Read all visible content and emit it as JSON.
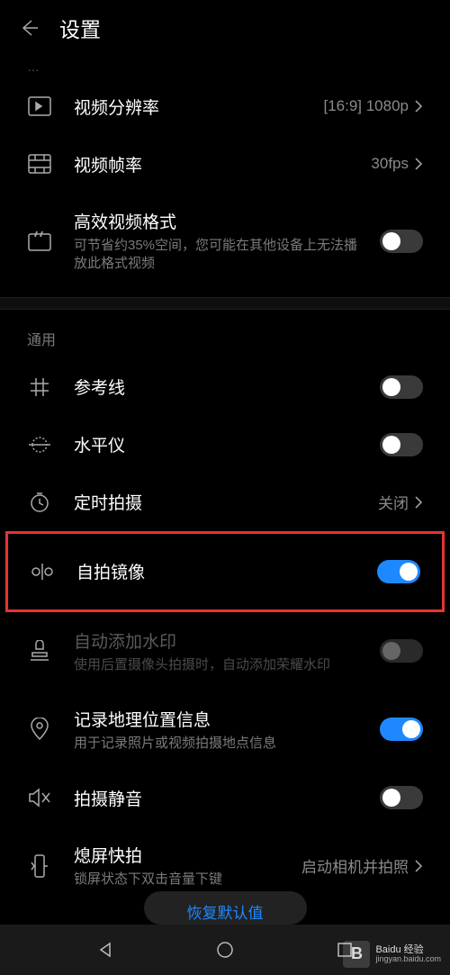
{
  "header": {
    "title": "设置"
  },
  "top_dim": "…",
  "rows": {
    "resolution": {
      "label": "视频分辨率",
      "value": "[16:9] 1080p"
    },
    "framerate": {
      "label": "视频帧率",
      "value": "30fps"
    },
    "hevc": {
      "label": "高效视频格式",
      "sub": "可节省约35%空间，您可能在其他设备上无法播放此格式视频",
      "on": false
    }
  },
  "section_general": "通用",
  "general": {
    "grid": {
      "label": "参考线",
      "on": false
    },
    "level": {
      "label": "水平仪",
      "on": false
    },
    "timer": {
      "label": "定时拍摄",
      "value": "关闭"
    },
    "mirror": {
      "label": "自拍镜像",
      "on": true
    },
    "watermark": {
      "label": "自动添加水印",
      "sub": "使用后置摄像头拍摄时，自动添加荣耀水印",
      "on": false,
      "disabled": true
    },
    "location": {
      "label": "记录地理位置信息",
      "sub": "用于记录照片或视频拍摄地点信息",
      "on": true
    },
    "mute": {
      "label": "拍摄静音",
      "on": false
    },
    "quickshot": {
      "label": "熄屏快拍",
      "sub": "锁屏状态下双击音量下键",
      "value": "启动相机并拍照"
    }
  },
  "restore_button": "恢复默认值",
  "watermark_brand": {
    "logo": "B",
    "name": "Baidu 经验",
    "url": "jingyan.baidu.com"
  }
}
